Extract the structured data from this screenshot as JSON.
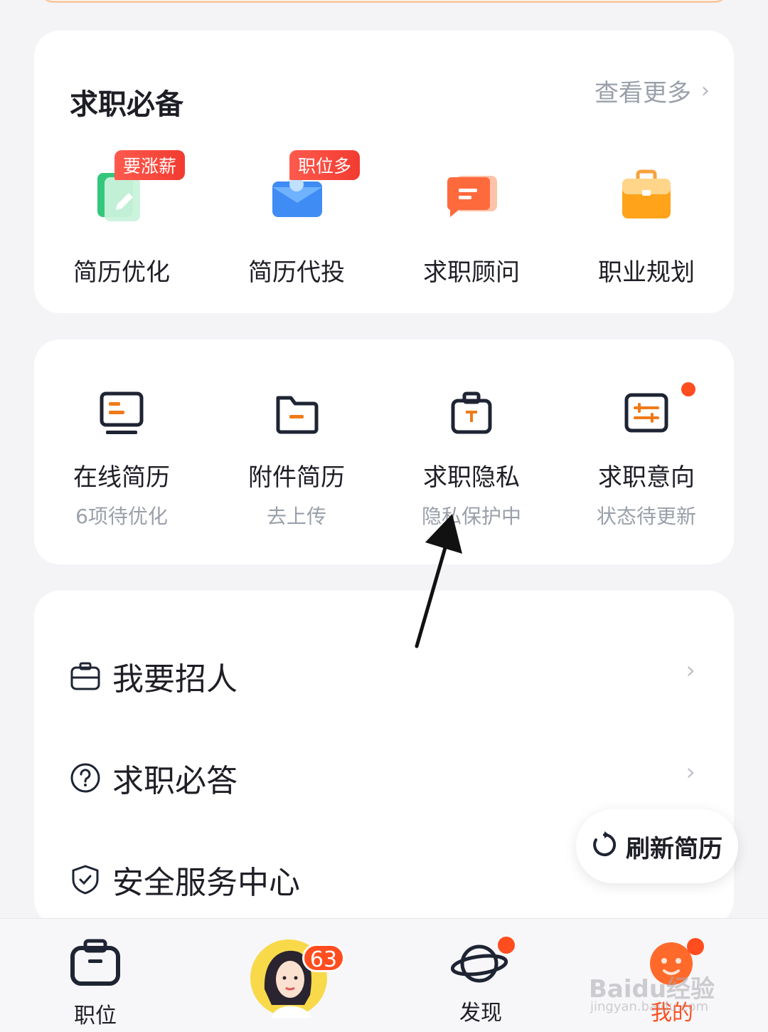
{
  "essentials": {
    "title": "求职必备",
    "more_label": "查看更多",
    "tools": [
      {
        "label": "简历优化",
        "tag": "要涨薪",
        "icon": "resume-edit-icon"
      },
      {
        "label": "简历代投",
        "tag": "职位多",
        "icon": "mail-star-icon"
      },
      {
        "label": "求职顾问",
        "tag": "",
        "icon": "chat-bubble-icon"
      },
      {
        "label": "职业规划",
        "tag": "",
        "icon": "briefcase-icon"
      }
    ]
  },
  "resume_tools": [
    {
      "label": "在线简历",
      "sub": "6项待优化",
      "icon": "monitor-icon"
    },
    {
      "label": "附件简历",
      "sub": "去上传",
      "icon": "folder-icon"
    },
    {
      "label": "求职隐私",
      "sub": "隐私保护中",
      "icon": "privacy-bag-icon"
    },
    {
      "label": "求职意向",
      "sub": "状态待更新",
      "icon": "sliders-icon"
    }
  ],
  "menu": [
    {
      "label": "我要招人",
      "icon": "briefcase-outline-icon"
    },
    {
      "label": "求职必答",
      "icon": "question-circle-icon"
    },
    {
      "label": "安全服务中心",
      "icon": "shield-check-icon"
    }
  ],
  "refresh_button": {
    "label": "刷新简历",
    "icon": "refresh-icon"
  },
  "tabbar": {
    "items": [
      {
        "label": "职位",
        "icon": "job-tab-icon"
      },
      {
        "label": "",
        "icon": "avatar-tab-icon",
        "badge": "63"
      },
      {
        "label": "发现",
        "icon": "planet-tab-icon"
      },
      {
        "label": "我的",
        "icon": "mine-tab-icon"
      }
    ]
  },
  "watermark": {
    "main": "Baidu经验",
    "sub": "jingyan.baidu.com"
  },
  "colors": {
    "accent": "#ff4d1f",
    "orange": "#f07a1a",
    "navy": "#1e2433",
    "tag_red": "#f23b30"
  }
}
